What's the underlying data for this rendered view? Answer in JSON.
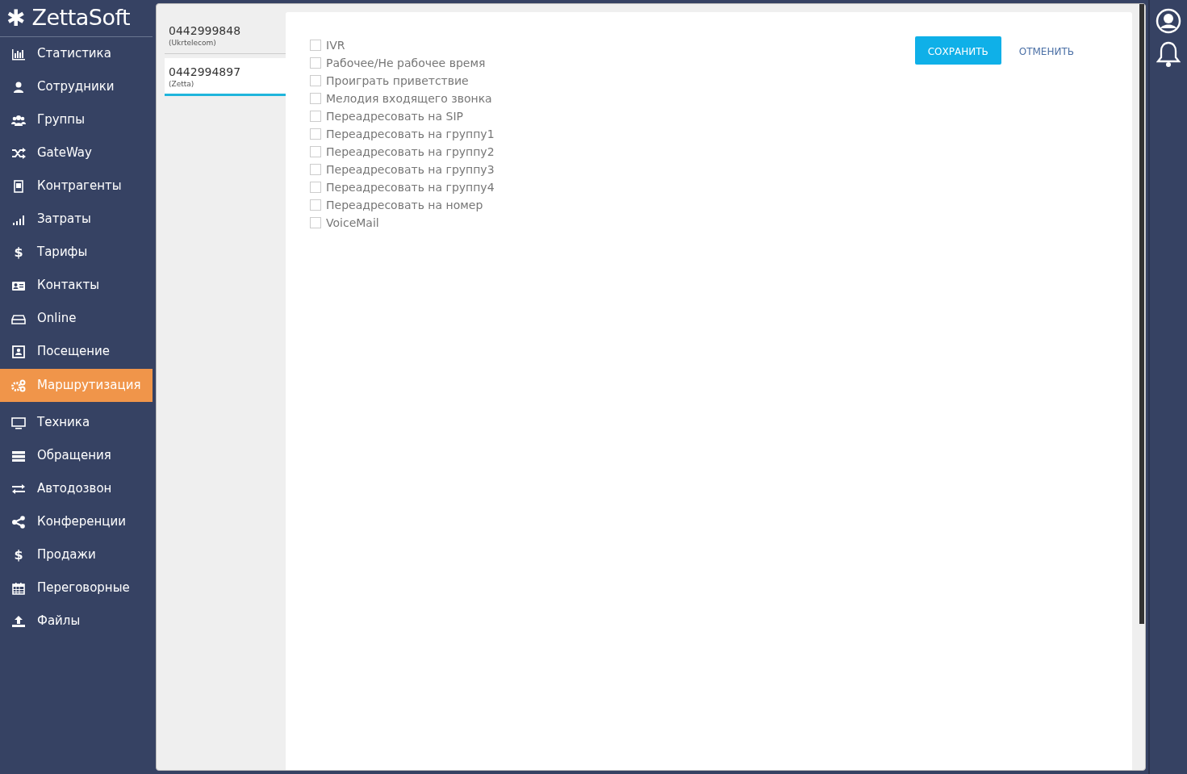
{
  "logo": {
    "icon_text": "✱",
    "title": "ZettaSoft"
  },
  "sidebar": {
    "items": [
      {
        "label": "Статистика",
        "selected": false
      },
      {
        "label": "Сотрудники",
        "selected": false
      },
      {
        "label": "Группы",
        "selected": false
      },
      {
        "label": "GateWay",
        "selected": false
      },
      {
        "label": "Контрагенты",
        "selected": false
      },
      {
        "label": "Затраты",
        "selected": false
      },
      {
        "label": "Тарифы",
        "selected": false,
        "icon_text": "$"
      },
      {
        "label": "Контакты",
        "selected": false
      },
      {
        "label": "Online",
        "selected": false
      },
      {
        "label": "Посещение",
        "selected": false
      },
      {
        "label": "Маршрутизация",
        "selected": true
      },
      {
        "label": "Техника",
        "selected": false
      },
      {
        "label": "Обращения",
        "selected": false
      },
      {
        "label": "Автодозвон",
        "selected": false
      },
      {
        "label": "Конференции",
        "selected": false
      },
      {
        "label": "Продажи",
        "selected": false,
        "icon_text": "$"
      },
      {
        "label": "Переговорные",
        "selected": false
      },
      {
        "label": "Файлы",
        "selected": false
      }
    ]
  },
  "numbers": [
    {
      "number": "0442999848",
      "provider": "(Ukrtelecom)",
      "selected": false
    },
    {
      "number": "0442994897",
      "provider": "(Zetta)",
      "selected": true
    }
  ],
  "options": [
    {
      "label": "IVR",
      "checked": false
    },
    {
      "label": "Рабочее/Не рабочее время",
      "checked": false
    },
    {
      "label": "Проиграть приветствие",
      "checked": false
    },
    {
      "label": "Мелодия входящего звонка",
      "checked": false
    },
    {
      "label": "Переадресовать на SIP",
      "checked": false
    },
    {
      "label": "Переадресовать на группу1",
      "checked": false
    },
    {
      "label": "Переадресовать на группу2",
      "checked": false
    },
    {
      "label": "Переадресовать на группу3",
      "checked": false
    },
    {
      "label": "Переадресовать на группу4",
      "checked": false
    },
    {
      "label": "Переадресовать на номер",
      "checked": false
    },
    {
      "label": "VoiceMail",
      "checked": false
    }
  ],
  "buttons": {
    "save": "СОХРАНИТЬ",
    "cancel": "ОТМЕНИТЬ"
  }
}
